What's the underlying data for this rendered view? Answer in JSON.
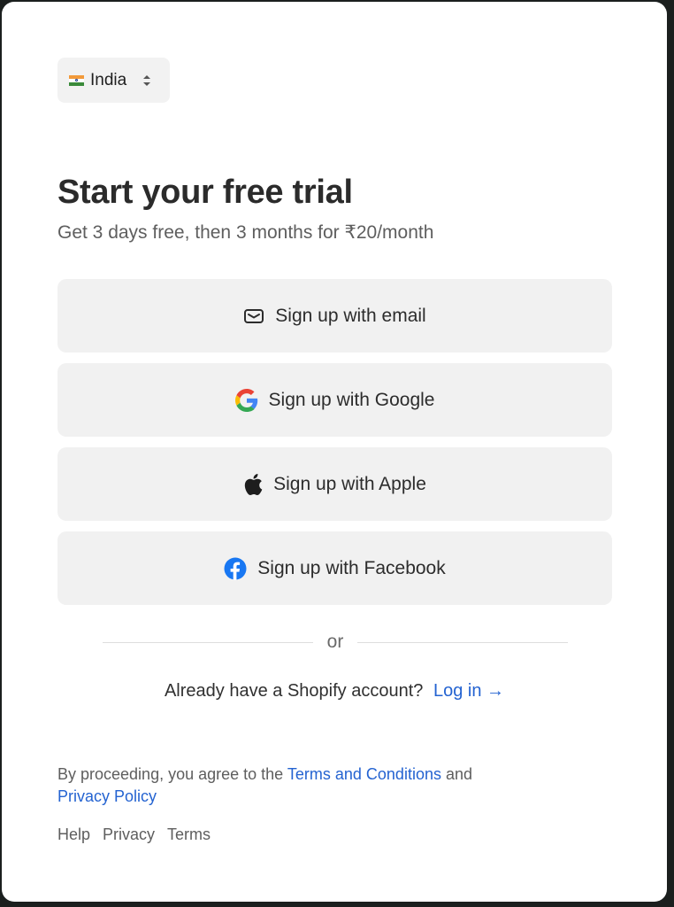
{
  "country_selector": {
    "label": "India",
    "flag_icon": "india-flag-icon"
  },
  "heading": "Start your free trial",
  "subtitle": "Get 3 days free, then 3 months for ₹20/month",
  "signup_buttons": [
    {
      "label": "Sign up with email",
      "icon": "mail-icon"
    },
    {
      "label": "Sign up with Google",
      "icon": "google-icon"
    },
    {
      "label": "Sign up with Apple",
      "icon": "apple-icon"
    },
    {
      "label": "Sign up with Facebook",
      "icon": "facebook-icon"
    }
  ],
  "divider_text": "or",
  "login": {
    "prompt": "Already have a Shopify account?",
    "link": "Log in",
    "arrow": "→"
  },
  "legal": {
    "prefix": "By proceeding, you agree to the",
    "terms_link": "Terms and Conditions",
    "and": "and",
    "privacy_link": "Privacy Policy"
  },
  "footer_links": [
    "Help",
    "Privacy",
    "Terms"
  ],
  "colors": {
    "link": "#2463d1",
    "button_bg": "#f1f1f1",
    "facebook": "#1877f2"
  }
}
